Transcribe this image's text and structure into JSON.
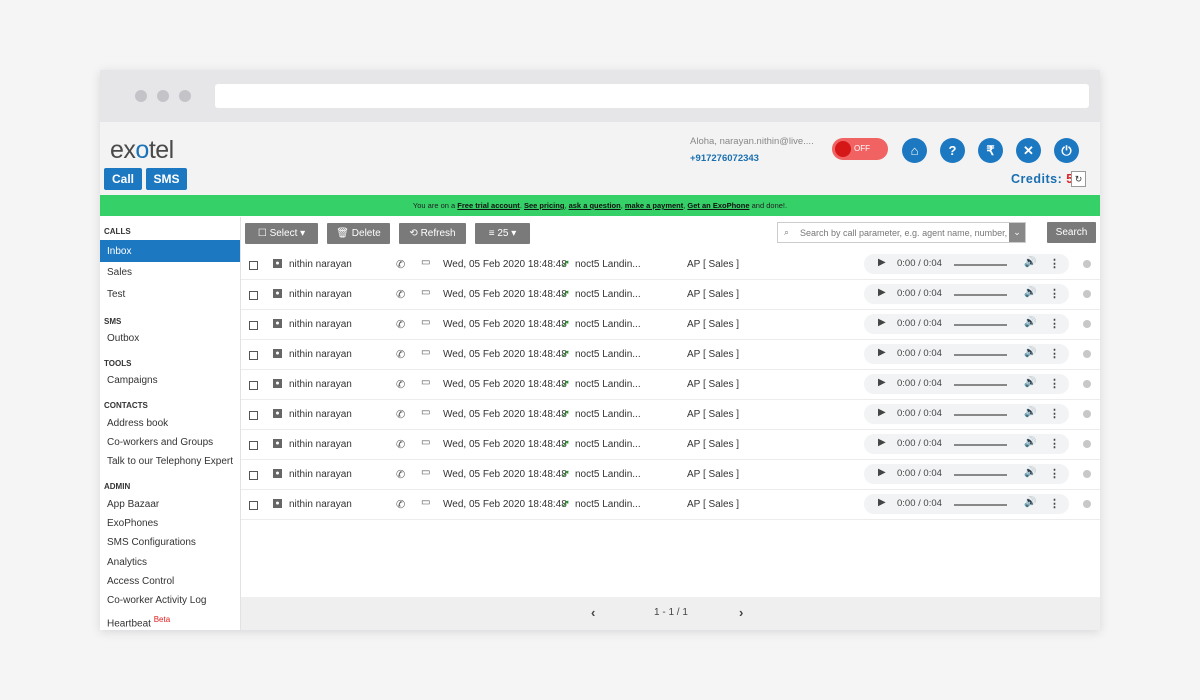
{
  "header": {
    "user": "Aloha, narayan.nithin@live....",
    "phone": "+917276072343",
    "toggle_label": "OFF",
    "logo": "exotel",
    "icons": [
      "home-icon",
      "help-icon",
      "rupee-icon",
      "tools-icon",
      "logout-icon"
    ]
  },
  "tabs": {
    "call": "Call",
    "sms": "SMS"
  },
  "credits": {
    "label": "Credits:",
    "value": "5"
  },
  "banner": {
    "prefix": "You are on a",
    "trial": "Free trial account",
    "pricing": "See pricing",
    "ask": "ask a question",
    "payment": "make a payment",
    "exophone": "Get an ExoPhone",
    "suffix": "and done!."
  },
  "sidebar": {
    "calls": "CALLS",
    "inbox": "Inbox",
    "sales": "Sales",
    "test": "Test",
    "sms": "SMS",
    "outbox": "Outbox",
    "tools": "TOOLS",
    "campaigns": "Campaigns",
    "contacts": "CONTACTS",
    "address_book": "Address book",
    "coworkers": "Co-workers and Groups",
    "expert": "Talk to our Telephony Expert",
    "admin": "ADMIN",
    "app_bazaar": "App Bazaar",
    "exophones": "ExoPhones",
    "sms_config": "SMS Configurations",
    "analytics": "Analytics",
    "access": "Access Control",
    "activity": "Co-worker Activity Log",
    "heartbeat": "Heartbeat",
    "beta": "Beta"
  },
  "toolbar": {
    "select": "Select",
    "delete": "Delete",
    "refresh": "Refresh",
    "per_page": "25",
    "search_placeholder": "Search by call parameter, e.g. agent name, number, etc.",
    "search_button": "Search"
  },
  "rows": [
    {
      "name": "nithin narayan",
      "date": "Wed, 05 Feb 2020 18:48:48",
      "to": "noct5 Landin...",
      "group": "AP [ Sales ]",
      "time": "0:00 / 0:04"
    },
    {
      "name": "nithin narayan",
      "date": "Wed, 05 Feb 2020 18:48:48",
      "to": "noct5 Landin...",
      "group": "AP [ Sales ]",
      "time": "0:00 / 0:04"
    },
    {
      "name": "nithin narayan",
      "date": "Wed, 05 Feb 2020 18:48:48",
      "to": "noct5 Landin...",
      "group": "AP [ Sales ]",
      "time": "0:00 / 0:04"
    },
    {
      "name": "nithin narayan",
      "date": "Wed, 05 Feb 2020 18:48:48",
      "to": "noct5 Landin...",
      "group": "AP [ Sales ]",
      "time": "0:00 / 0:04"
    },
    {
      "name": "nithin narayan",
      "date": "Wed, 05 Feb 2020 18:48:48",
      "to": "noct5 Landin...",
      "group": "AP [ Sales ]",
      "time": "0:00 / 0:04"
    },
    {
      "name": "nithin narayan",
      "date": "Wed, 05 Feb 2020 18:48:48",
      "to": "noct5 Landin...",
      "group": "AP [ Sales ]",
      "time": "0:00 / 0:04"
    },
    {
      "name": "nithin narayan",
      "date": "Wed, 05 Feb 2020 18:48:48",
      "to": "noct5 Landin...",
      "group": "AP [ Sales ]",
      "time": "0:00 / 0:04"
    },
    {
      "name": "nithin narayan",
      "date": "Wed, 05 Feb 2020 18:48:48",
      "to": "noct5 Landin...",
      "group": "AP [ Sales ]",
      "time": "0:00 / 0:04"
    },
    {
      "name": "nithin narayan",
      "date": "Wed, 05 Feb 2020 18:48:48",
      "to": "noct5 Landin...",
      "group": "AP [ Sales ]",
      "time": "0:00 / 0:04"
    }
  ],
  "pager": {
    "text": "1 - 1 / 1"
  },
  "colors": {
    "accent": "#1d78c2",
    "banner": "#36d068",
    "credit_value": "#e02020"
  }
}
